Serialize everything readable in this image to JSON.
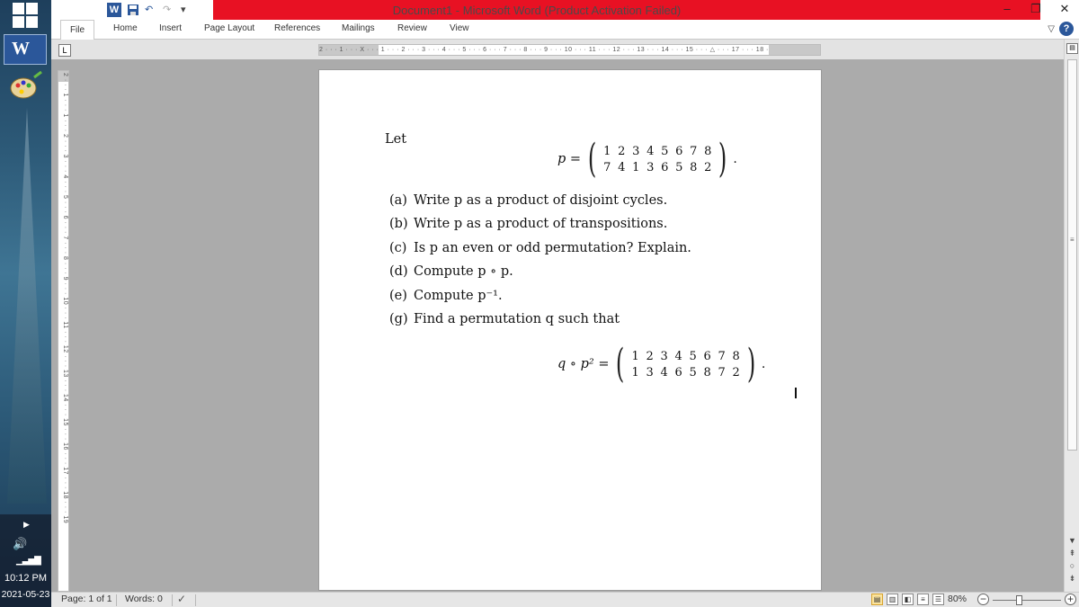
{
  "window": {
    "title": "Document1 - Microsoft Word (Product Activation Failed)",
    "minimize": "–",
    "restore": "❐",
    "close": "✕"
  },
  "qat": {
    "word_logo": "W",
    "undo": "↶",
    "redo": "↷"
  },
  "tabs": [
    "File",
    "Home",
    "Insert",
    "Page Layout",
    "References",
    "Mailings",
    "Review",
    "View"
  ],
  "help": {
    "caret": "▽",
    "question": "?"
  },
  "ruler": {
    "tab_selector": "L",
    "horizontal": "2 · · · 1 · · · X · · · 1 · · · 2 · · · 3 · · · 4 · · · 5 · · · 6 · · · 7 · · · 8 · · · 9 · · · 10 · · · 11 · · · 12 · · · 13 · · · 14 · · · 15 · · · △ · · · 17 · · · 18 ·",
    "vertical": "2 · · · 1 · · · 1 · · · 2 · · · 3 · · · 4 · · · 5 · · · 6 · · · 7 · · · 8 · · · 9 · · · 10 · · · 11 · · · 12 · · · 13 · · · 14 · · · 15 · · · 16 · · · 17 · · · 18 · · · 19"
  },
  "document": {
    "intro": "Let",
    "p_lhs": "p =",
    "p_row1": [
      "1",
      "2",
      "3",
      "4",
      "5",
      "6",
      "7",
      "8"
    ],
    "p_row2": [
      "7",
      "4",
      "1",
      "3",
      "6",
      "5",
      "8",
      "2"
    ],
    "items": [
      {
        "label": "(a)",
        "text": "Write p as a product of disjoint cycles."
      },
      {
        "label": "(b)",
        "text": "Write p as a product of transpositions."
      },
      {
        "label": "(c)",
        "text": "Is p an even or odd permutation? Explain."
      },
      {
        "label": "(d)",
        "text": "Compute p ∘ p."
      },
      {
        "label": "(e)",
        "text": "Compute p⁻¹."
      },
      {
        "label": "(g)",
        "text": "Find a permutation q such that"
      }
    ],
    "q_lhs": "q ∘ p² =",
    "q_row1": [
      "1",
      "2",
      "3",
      "4",
      "5",
      "6",
      "7",
      "8"
    ],
    "q_row2": [
      "1",
      "3",
      "4",
      "6",
      "5",
      "8",
      "7",
      "2"
    ],
    "period": "."
  },
  "desktop": {
    "word_tile": "W",
    "time": "10:12 PM",
    "date": "2021-05-23"
  },
  "status": {
    "page": "Page: 1 of 1",
    "words": "Words: 0",
    "zoom": "80%",
    "zoom_minus": "−",
    "zoom_plus": "+"
  },
  "colors": {
    "title_error": "#e81123",
    "word_blue": "#2b579a"
  }
}
